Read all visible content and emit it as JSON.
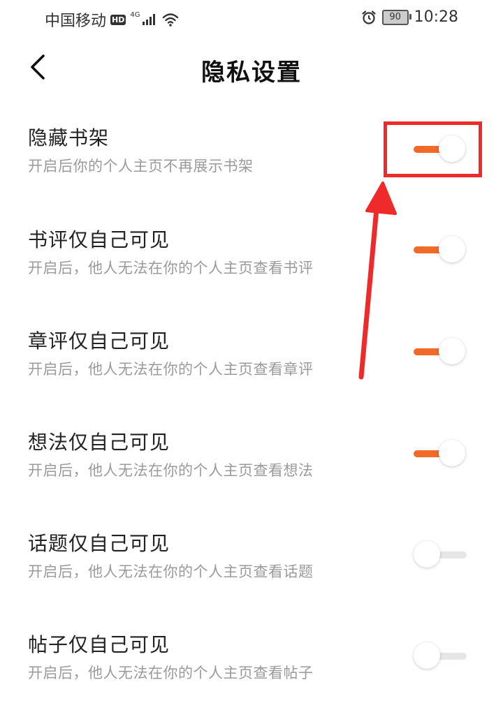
{
  "status_bar": {
    "carrier": "中国移动",
    "hd_badge": "HD",
    "network": "4G",
    "battery_level": "90",
    "time": "10:28"
  },
  "header": {
    "title": "隐私设置"
  },
  "settings": [
    {
      "title": "隐藏书架",
      "subtitle": "开启后你的个人主页不再展示书架",
      "enabled": true
    },
    {
      "title": "书评仅自己可见",
      "subtitle": "开启后，他人无法在你的个人主页查看书评",
      "enabled": true
    },
    {
      "title": "章评仅自己可见",
      "subtitle": "开启后，他人无法在你的个人主页查看章评",
      "enabled": true
    },
    {
      "title": "想法仅自己可见",
      "subtitle": "开启后，他人无法在你的个人主页查看想法",
      "enabled": true
    },
    {
      "title": "话题仅自己可见",
      "subtitle": "开启后，他人无法在你的个人主页查看话题",
      "enabled": false
    },
    {
      "title": "帖子仅自己可见",
      "subtitle": "开启后，他人无法在你的个人主页查看帖子",
      "enabled": false
    }
  ],
  "colors": {
    "toggle_on": "#f26a2a",
    "toggle_off": "#e6e6e6",
    "annotation": "#ee2a2a"
  },
  "icons": {
    "back": "chevron-left-icon",
    "wifi": "wifi-icon",
    "alarm": "alarm-icon",
    "signal": "signal-icon"
  }
}
